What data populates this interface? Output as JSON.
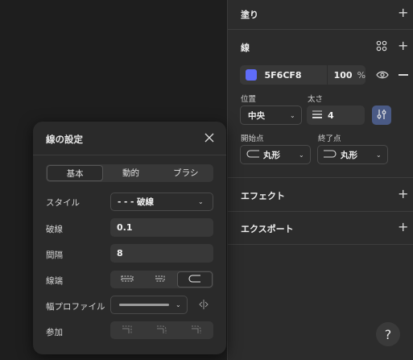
{
  "panel": {
    "fill": {
      "title": "塗り"
    },
    "stroke": {
      "title": "線",
      "color_hex": "5F6CF8",
      "color": "#5F6CF8",
      "opacity": "100",
      "opacity_unit": "%",
      "position_label": "位置",
      "position_value": "中央",
      "weight_label": "太さ",
      "weight_value": "4",
      "start_label": "開始点",
      "start_value": "丸形",
      "end_label": "終了点",
      "end_value": "丸形"
    },
    "effects": {
      "title": "エフェクト"
    },
    "export": {
      "title": "エクスポート"
    }
  },
  "dialog": {
    "title": "線の設定",
    "tabs": [
      "基本",
      "動的",
      "ブラシ"
    ],
    "active_tab": "基本",
    "style_label": "スタイル",
    "style_value": "- - -  破線",
    "dash_label": "破線",
    "dash_value": "0.1",
    "gap_label": "間隔",
    "gap_value": "8",
    "cap_label": "線端",
    "width_profile_label": "幅プロファイル",
    "join_label": "参加"
  },
  "help": {
    "label": "?"
  },
  "icons": {
    "plus": "plus-icon",
    "grid": "style-grid-icon",
    "eye": "eye-icon",
    "minus": "minus-icon",
    "close": "close-icon",
    "weight": "stroke-weight-icon",
    "settings": "stroke-settings-icon",
    "flip": "flip-icon"
  }
}
